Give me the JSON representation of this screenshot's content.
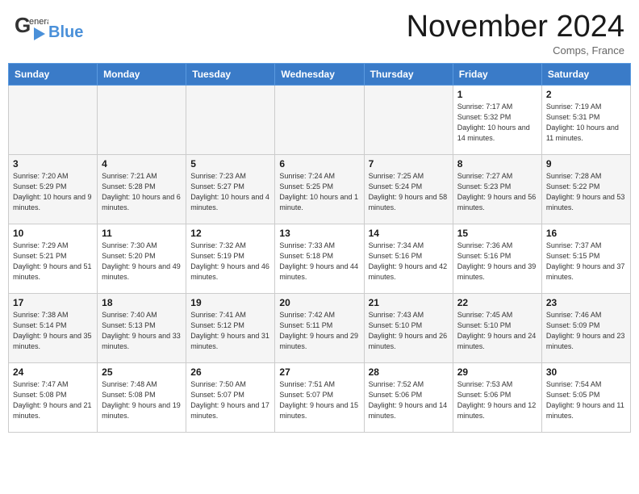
{
  "header": {
    "logo_general": "General",
    "logo_blue": "Blue",
    "month_title": "November 2024",
    "location": "Comps, France"
  },
  "weekdays": [
    "Sunday",
    "Monday",
    "Tuesday",
    "Wednesday",
    "Thursday",
    "Friday",
    "Saturday"
  ],
  "weeks": [
    [
      {
        "day": "",
        "empty": true
      },
      {
        "day": "",
        "empty": true
      },
      {
        "day": "",
        "empty": true
      },
      {
        "day": "",
        "empty": true
      },
      {
        "day": "",
        "empty": true
      },
      {
        "day": "1",
        "sunrise": "Sunrise: 7:17 AM",
        "sunset": "Sunset: 5:32 PM",
        "daylight": "Daylight: 10 hours and 14 minutes."
      },
      {
        "day": "2",
        "sunrise": "Sunrise: 7:19 AM",
        "sunset": "Sunset: 5:31 PM",
        "daylight": "Daylight: 10 hours and 11 minutes."
      }
    ],
    [
      {
        "day": "3",
        "sunrise": "Sunrise: 7:20 AM",
        "sunset": "Sunset: 5:29 PM",
        "daylight": "Daylight: 10 hours and 9 minutes."
      },
      {
        "day": "4",
        "sunrise": "Sunrise: 7:21 AM",
        "sunset": "Sunset: 5:28 PM",
        "daylight": "Daylight: 10 hours and 6 minutes."
      },
      {
        "day": "5",
        "sunrise": "Sunrise: 7:23 AM",
        "sunset": "Sunset: 5:27 PM",
        "daylight": "Daylight: 10 hours and 4 minutes."
      },
      {
        "day": "6",
        "sunrise": "Sunrise: 7:24 AM",
        "sunset": "Sunset: 5:25 PM",
        "daylight": "Daylight: 10 hours and 1 minute."
      },
      {
        "day": "7",
        "sunrise": "Sunrise: 7:25 AM",
        "sunset": "Sunset: 5:24 PM",
        "daylight": "Daylight: 9 hours and 58 minutes."
      },
      {
        "day": "8",
        "sunrise": "Sunrise: 7:27 AM",
        "sunset": "Sunset: 5:23 PM",
        "daylight": "Daylight: 9 hours and 56 minutes."
      },
      {
        "day": "9",
        "sunrise": "Sunrise: 7:28 AM",
        "sunset": "Sunset: 5:22 PM",
        "daylight": "Daylight: 9 hours and 53 minutes."
      }
    ],
    [
      {
        "day": "10",
        "sunrise": "Sunrise: 7:29 AM",
        "sunset": "Sunset: 5:21 PM",
        "daylight": "Daylight: 9 hours and 51 minutes."
      },
      {
        "day": "11",
        "sunrise": "Sunrise: 7:30 AM",
        "sunset": "Sunset: 5:20 PM",
        "daylight": "Daylight: 9 hours and 49 minutes."
      },
      {
        "day": "12",
        "sunrise": "Sunrise: 7:32 AM",
        "sunset": "Sunset: 5:19 PM",
        "daylight": "Daylight: 9 hours and 46 minutes."
      },
      {
        "day": "13",
        "sunrise": "Sunrise: 7:33 AM",
        "sunset": "Sunset: 5:18 PM",
        "daylight": "Daylight: 9 hours and 44 minutes."
      },
      {
        "day": "14",
        "sunrise": "Sunrise: 7:34 AM",
        "sunset": "Sunset: 5:16 PM",
        "daylight": "Daylight: 9 hours and 42 minutes."
      },
      {
        "day": "15",
        "sunrise": "Sunrise: 7:36 AM",
        "sunset": "Sunset: 5:16 PM",
        "daylight": "Daylight: 9 hours and 39 minutes."
      },
      {
        "day": "16",
        "sunrise": "Sunrise: 7:37 AM",
        "sunset": "Sunset: 5:15 PM",
        "daylight": "Daylight: 9 hours and 37 minutes."
      }
    ],
    [
      {
        "day": "17",
        "sunrise": "Sunrise: 7:38 AM",
        "sunset": "Sunset: 5:14 PM",
        "daylight": "Daylight: 9 hours and 35 minutes."
      },
      {
        "day": "18",
        "sunrise": "Sunrise: 7:40 AM",
        "sunset": "Sunset: 5:13 PM",
        "daylight": "Daylight: 9 hours and 33 minutes."
      },
      {
        "day": "19",
        "sunrise": "Sunrise: 7:41 AM",
        "sunset": "Sunset: 5:12 PM",
        "daylight": "Daylight: 9 hours and 31 minutes."
      },
      {
        "day": "20",
        "sunrise": "Sunrise: 7:42 AM",
        "sunset": "Sunset: 5:11 PM",
        "daylight": "Daylight: 9 hours and 29 minutes."
      },
      {
        "day": "21",
        "sunrise": "Sunrise: 7:43 AM",
        "sunset": "Sunset: 5:10 PM",
        "daylight": "Daylight: 9 hours and 26 minutes."
      },
      {
        "day": "22",
        "sunrise": "Sunrise: 7:45 AM",
        "sunset": "Sunset: 5:10 PM",
        "daylight": "Daylight: 9 hours and 24 minutes."
      },
      {
        "day": "23",
        "sunrise": "Sunrise: 7:46 AM",
        "sunset": "Sunset: 5:09 PM",
        "daylight": "Daylight: 9 hours and 23 minutes."
      }
    ],
    [
      {
        "day": "24",
        "sunrise": "Sunrise: 7:47 AM",
        "sunset": "Sunset: 5:08 PM",
        "daylight": "Daylight: 9 hours and 21 minutes."
      },
      {
        "day": "25",
        "sunrise": "Sunrise: 7:48 AM",
        "sunset": "Sunset: 5:08 PM",
        "daylight": "Daylight: 9 hours and 19 minutes."
      },
      {
        "day": "26",
        "sunrise": "Sunrise: 7:50 AM",
        "sunset": "Sunset: 5:07 PM",
        "daylight": "Daylight: 9 hours and 17 minutes."
      },
      {
        "day": "27",
        "sunrise": "Sunrise: 7:51 AM",
        "sunset": "Sunset: 5:07 PM",
        "daylight": "Daylight: 9 hours and 15 minutes."
      },
      {
        "day": "28",
        "sunrise": "Sunrise: 7:52 AM",
        "sunset": "Sunset: 5:06 PM",
        "daylight": "Daylight: 9 hours and 14 minutes."
      },
      {
        "day": "29",
        "sunrise": "Sunrise: 7:53 AM",
        "sunset": "Sunset: 5:06 PM",
        "daylight": "Daylight: 9 hours and 12 minutes."
      },
      {
        "day": "30",
        "sunrise": "Sunrise: 7:54 AM",
        "sunset": "Sunset: 5:05 PM",
        "daylight": "Daylight: 9 hours and 11 minutes."
      }
    ]
  ]
}
